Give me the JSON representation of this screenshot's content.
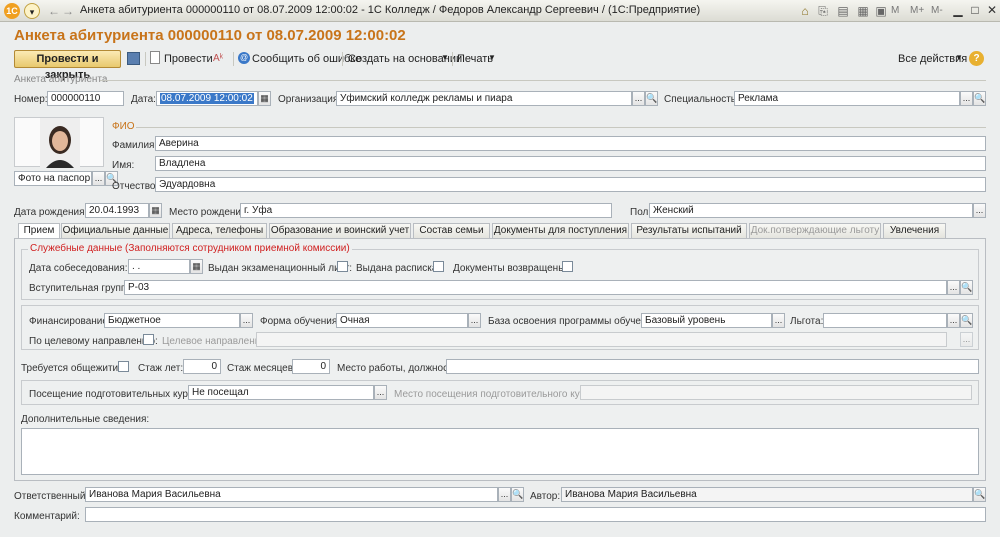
{
  "window": {
    "title": "Анкета абитуриента 000000110 от 08.07.2009 12:00:02 - 1С Колледж / Федоров Александр Сергеевич / (1С:Предприятие)",
    "logo": "1С",
    "toolbar_right": [
      "M",
      "M+",
      "M-"
    ]
  },
  "form": {
    "heading": "Анкета абитуриента 000000110 от 08.07.2009 12:00:02"
  },
  "toolbar": {
    "post_close": "Провести и закрыть",
    "post": "Провести",
    "report_error": "Сообщить об ошибке",
    "create_based": "Создать на основании",
    "print": "Печать",
    "all_actions": "Все действия",
    "help": "?"
  },
  "header": {
    "group_title": "Анкета абитуриента",
    "number_label": "Номер:",
    "number": "000000110",
    "date_label": "Дата:",
    "date": "08.07.2009 12:00:02",
    "org_label": "Организация:",
    "org": "Уфимский колледж рекламы и пиара",
    "spec_label": "Специальность:",
    "spec": "Реклама"
  },
  "fio": {
    "group_title": "ФИО",
    "surname_label": "Фамилия:",
    "surname": "Аверина",
    "name_label": "Имя:",
    "name": "Владлена",
    "patronymic_label": "Отчество:",
    "patronymic": "Эдуардовна",
    "photo_field": "Фото на паспор"
  },
  "birth": {
    "date_label": "Дата рождения:",
    "date": "20.04.1993",
    "place_label": "Место рождения:",
    "place": "г. Уфа",
    "gender_label": "Пол:",
    "gender": "Женский"
  },
  "tabs": [
    {
      "label": "Прием"
    },
    {
      "label": "Официальные данные"
    },
    {
      "label": "Адреса, телефоны"
    },
    {
      "label": "Образование и воинский учет"
    },
    {
      "label": "Состав семьи"
    },
    {
      "label": "Документы для поступления"
    },
    {
      "label": "Результаты испытаний"
    },
    {
      "label": "Док.потверждающие льготу"
    },
    {
      "label": "Увлечения"
    }
  ],
  "admission": {
    "service_title": "Служебные данные (Заполняются сотрудником приемной комиссии)",
    "interview_label": "Дата собеседования:",
    "interview_value": " .  .",
    "exam_sheet_label": "Выдан экзаменационный лист:",
    "receipt_label": "Выдана расписка:",
    "docs_returned_label": "Документы возвращены:",
    "group_label": "Вступительная группа:",
    "group_value": "Р-03",
    "funding_label": "Финансирование:",
    "funding": "Бюджетное",
    "study_form_label": "Форма обучения:",
    "study_form": "Очная",
    "base_label": "База освоения программы обучения:",
    "base": "Базовый уровень",
    "benefit_label": "Льгота:",
    "benefit": "",
    "targeted_label": "По целевому направлению:",
    "targeted_dir_label": "Целевое направление:",
    "dormitory_label": "Требуется общежитие:",
    "exp_years_label": "Стаж лет:",
    "exp_years": "0",
    "exp_months_label": "Стаж месяцев:",
    "exp_months": "0",
    "job_label": "Место работы, должность:",
    "courses_label": "Посещение подготовительных курсов:",
    "courses": "Не посещал",
    "courses_place_label": "Место посещения подготовительного курса:",
    "extra_label": "Дополнительные сведения:"
  },
  "footer": {
    "responsible_label": "Ответственный:",
    "responsible": "Иванова Мария Васильевна",
    "author_label": "Автор:",
    "author": "Иванова Мария Васильевна",
    "comment_label": "Комментарий:"
  },
  "icons": {
    "ellipsis": "...",
    "search": "🔍",
    "calendar": "▦"
  }
}
